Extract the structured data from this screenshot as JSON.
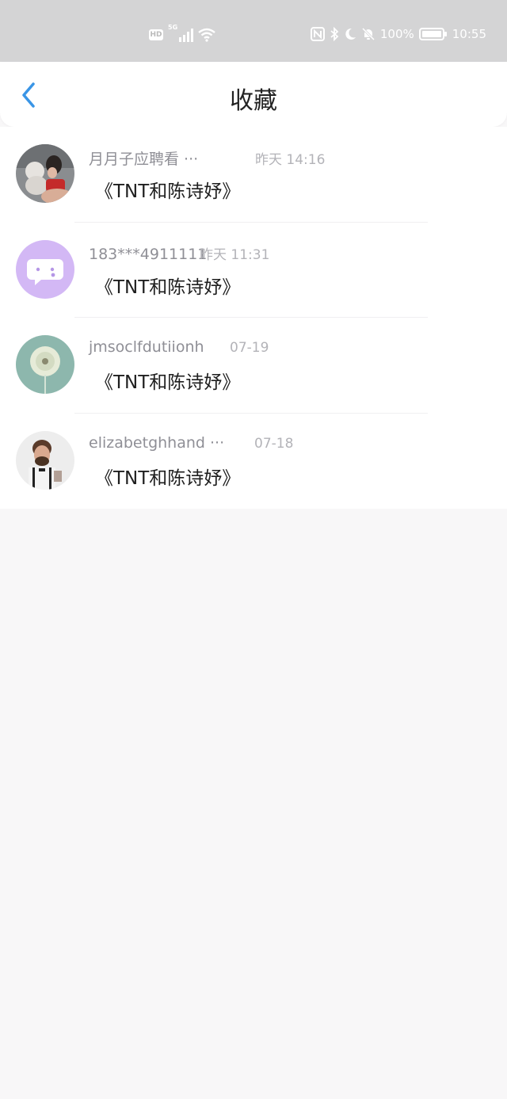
{
  "status_bar": {
    "hd": "HD",
    "network": "5G",
    "battery": "100%",
    "time": "10:55"
  },
  "header": {
    "title": "收藏"
  },
  "favorites": [
    {
      "name": "月月子应聘看 ···",
      "time": "昨天 14:16",
      "title": "《TNT和陈诗妤》",
      "avatar": "woman-with-cat-photo"
    },
    {
      "name": "183***4911111",
      "time": "昨天 11:31",
      "title": "《TNT和陈诗妤》",
      "avatar": "chat-bubble-avatar"
    },
    {
      "name": "jmsoclfdutiionh",
      "time": "07-19",
      "title": "《TNT和陈诗妤》",
      "avatar": "dandelion-photo"
    },
    {
      "name": "elizabetghhand ···",
      "time": "07-18",
      "title": "《TNT和陈诗妤》",
      "avatar": "man-portrait-photo"
    }
  ],
  "colors": {
    "accent": "#3a95e6",
    "status_bar_bg": "#d4d4d5",
    "page_bg": "#f8f7f8",
    "avatar_purple": "#d3b8f5"
  }
}
